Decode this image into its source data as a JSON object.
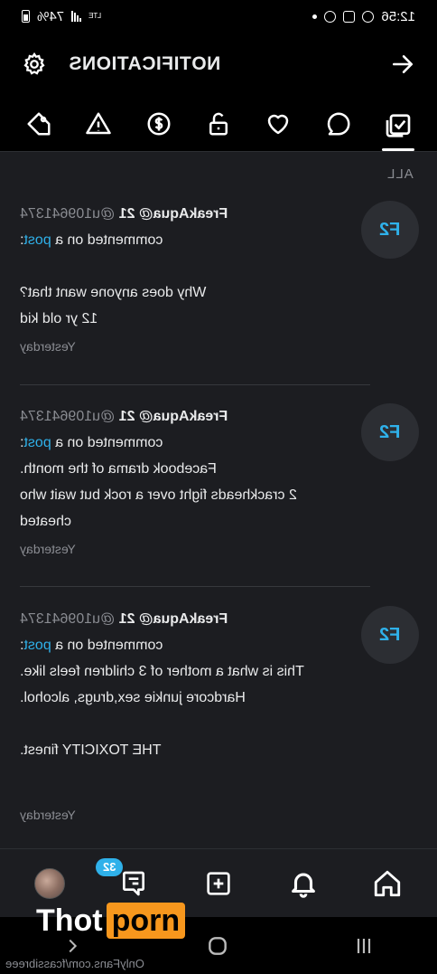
{
  "status_bar": {
    "time": "12:56",
    "battery": "74%",
    "network": "LTE"
  },
  "header": {
    "title": "NOTIFICATIONS"
  },
  "tabs": [
    {
      "name": "all",
      "icon": "check-square-icon",
      "active": true
    },
    {
      "name": "comments",
      "icon": "comment-icon"
    },
    {
      "name": "likes",
      "icon": "heart-icon"
    },
    {
      "name": "subscriptions",
      "icon": "unlock-icon"
    },
    {
      "name": "tips",
      "icon": "dollar-icon"
    },
    {
      "name": "alerts",
      "icon": "warning-icon"
    },
    {
      "name": "promotions",
      "icon": "tag-icon"
    }
  ],
  "section_label": "ALL",
  "notifications": [
    {
      "avatar_initials": "F2",
      "username": "FreakAqua@ 21",
      "handle": "@u109641374",
      "action_prefix": "commented on a",
      "action_link": "post",
      "action_suffix": ":",
      "message_lines": [
        "Why does anyone want that?",
        "12 yr old kid"
      ],
      "time": "Yesterday"
    },
    {
      "avatar_initials": "F2",
      "username": "FreakAqua@ 21",
      "handle": "@u109641374",
      "action_prefix": "commented on a",
      "action_link": "post",
      "action_suffix": ":",
      "message_lines": [
        "Facebook drama of the month.",
        "2 crackheads fight over a rock but wait who cheated"
      ],
      "time": "Yesterday"
    },
    {
      "avatar_initials": "F2",
      "username": "FreakAqua@ 21",
      "handle": "@u109641374",
      "action_prefix": "commented on a",
      "action_link": "post",
      "action_suffix": ":",
      "message_lines": [
        "This is what a mother of 3 children feels like. Hardcore junkie sex,drugs, alcohol.",
        "",
        "THE TOXICITY finest.",
        ""
      ],
      "time": "Yesterday"
    }
  ],
  "bottom_nav": {
    "messages_badge": "32"
  },
  "watermark": {
    "part1": "Thot",
    "part2": "porn",
    "url": "OnlyFans.com/fcassibreee"
  },
  "colors": {
    "accent": "#2fb1ea",
    "background": "#1c1d21",
    "watermark_orange": "#f7971d"
  }
}
